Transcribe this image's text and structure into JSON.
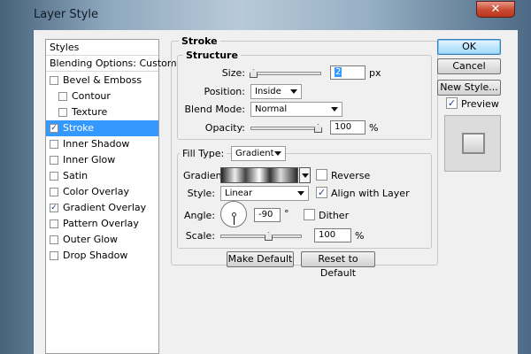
{
  "window": {
    "title": "Layer Style",
    "close_glyph": "✕"
  },
  "style_list": {
    "header": "Styles",
    "blending": "Blending Options: Custom",
    "items": [
      {
        "label": "Bevel & Emboss",
        "checked": false,
        "selected": false,
        "indent": false
      },
      {
        "label": "Contour",
        "checked": false,
        "selected": false,
        "indent": true
      },
      {
        "label": "Texture",
        "checked": false,
        "selected": false,
        "indent": true
      },
      {
        "label": "Stroke",
        "checked": true,
        "selected": true,
        "indent": false
      },
      {
        "label": "Inner Shadow",
        "checked": false,
        "selected": false,
        "indent": false
      },
      {
        "label": "Inner Glow",
        "checked": false,
        "selected": false,
        "indent": false
      },
      {
        "label": "Satin",
        "checked": false,
        "selected": false,
        "indent": false
      },
      {
        "label": "Color Overlay",
        "checked": false,
        "selected": false,
        "indent": false
      },
      {
        "label": "Gradient Overlay",
        "checked": true,
        "selected": false,
        "indent": false
      },
      {
        "label": "Pattern Overlay",
        "checked": false,
        "selected": false,
        "indent": false
      },
      {
        "label": "Outer Glow",
        "checked": false,
        "selected": false,
        "indent": false
      },
      {
        "label": "Drop Shadow",
        "checked": false,
        "selected": false,
        "indent": false
      }
    ]
  },
  "stroke": {
    "title": "Stroke",
    "structure": {
      "title": "Structure",
      "size_label": "Size:",
      "size_value": "2",
      "size_unit": "px",
      "position_label": "Position:",
      "position_value": "Inside",
      "blend_label": "Blend Mode:",
      "blend_value": "Normal",
      "opacity_label": "Opacity:",
      "opacity_value": "100",
      "opacity_unit": "%"
    },
    "fill": {
      "type_label": "Fill Type:",
      "type_value": "Gradient",
      "gradient_label": "Gradient:",
      "reverse_label": "Reverse",
      "reverse_checked": false,
      "style_label": "Style:",
      "style_value": "Linear",
      "align_label": "Align with Layer",
      "align_checked": true,
      "angle_label": "Angle:",
      "angle_value": "-90",
      "angle_unit": "°",
      "dither_label": "Dither",
      "dither_checked": false,
      "scale_label": "Scale:",
      "scale_value": "100",
      "scale_unit": "%"
    },
    "make_default": "Make Default",
    "reset_default": "Reset to Default"
  },
  "buttons": {
    "ok": "OK",
    "cancel": "Cancel",
    "new_style": "New Style..."
  },
  "preview": {
    "label": "Preview",
    "checked": true
  },
  "check_glyph": "✓",
  "accent_color": "#3399ff"
}
